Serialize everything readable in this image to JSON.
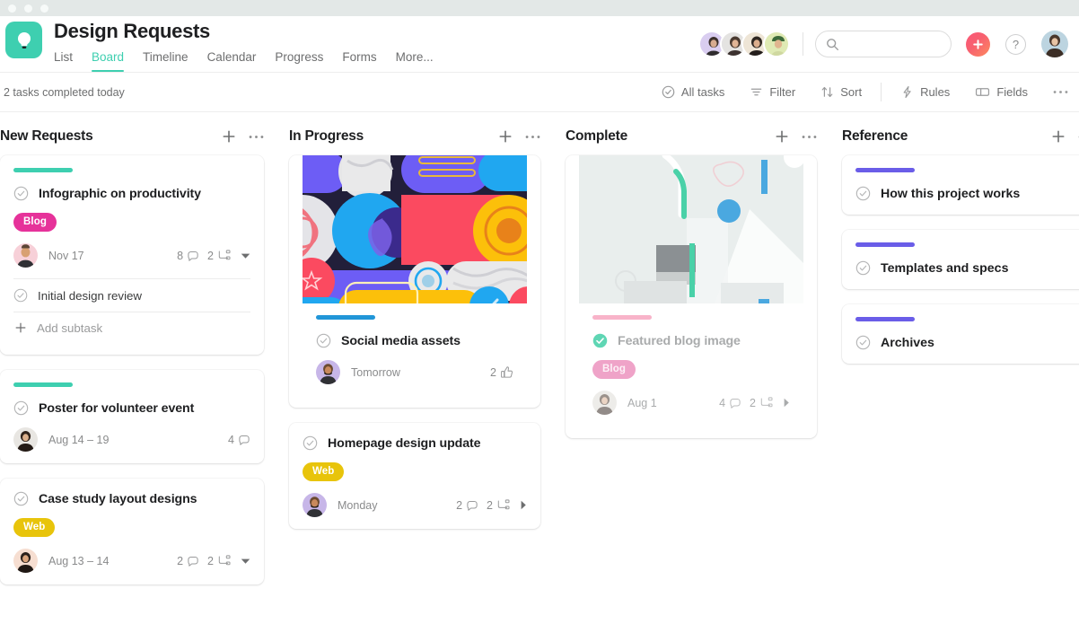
{
  "window": {
    "dots": 3
  },
  "header": {
    "project_title": "Design Requests",
    "logo_icon": "lightbulb-icon",
    "tabs": [
      {
        "label": "List",
        "active": false
      },
      {
        "label": "Board",
        "active": true
      },
      {
        "label": "Timeline",
        "active": false
      },
      {
        "label": "Calendar",
        "active": false
      },
      {
        "label": "Progress",
        "active": false
      },
      {
        "label": "Forms",
        "active": false
      },
      {
        "label": "More...",
        "active": false
      }
    ],
    "accent_color": "#3ecfb0",
    "members": [
      {
        "name": "member-1",
        "bg": "#d9cdf0"
      },
      {
        "name": "member-2",
        "bg": "#e4e3e1"
      },
      {
        "name": "member-3",
        "bg": "#eee5d6"
      },
      {
        "name": "member-4",
        "bg": "#dfeab4"
      }
    ],
    "search": {
      "placeholder": "",
      "value": "",
      "icon": "search-icon"
    },
    "add_button": {
      "icon": "plus-icon",
      "color": "#f7616f"
    },
    "help_button": {
      "label": "?"
    },
    "user_avatar": {
      "name": "current-user",
      "bg": "#bcd4e0"
    }
  },
  "toolbar": {
    "status_text": "2 tasks completed today",
    "items": [
      {
        "label": "All tasks",
        "icon": "check-circle-icon"
      },
      {
        "label": "Filter",
        "icon": "filter-icon"
      },
      {
        "label": "Sort",
        "icon": "sort-icon"
      },
      {
        "label": "Rules",
        "icon": "bolt-icon"
      },
      {
        "label": "Fields",
        "icon": "fields-icon"
      }
    ],
    "overflow_icon": "ellipsis-icon"
  },
  "board": {
    "add_icon": "plus-icon",
    "menu_icon": "ellipsis-icon",
    "columns": [
      {
        "title": "New Requests",
        "cards": [
          {
            "title": "Infographic on productivity",
            "progress_color": "#3ecfb0",
            "tag": {
              "label": "Blog",
              "color": "#e6329a"
            },
            "assignee_bg": "#f7d0d8",
            "date": "Nov 17",
            "stats": [
              {
                "value": "8",
                "icon": "comment-icon"
              },
              {
                "value": "2",
                "icon": "subtask-icon"
              }
            ],
            "expand_icon": "caret-down-icon",
            "subtasks": [
              {
                "label": "Initial design review"
              }
            ],
            "add_subtask_label": "Add subtask"
          },
          {
            "title": "Poster for volunteer event",
            "progress_color": "#3ecfb0",
            "assignee_bg": "#e8e6e2",
            "date": "Aug 14 – 19",
            "stats": [
              {
                "value": "4",
                "icon": "comment-icon"
              }
            ]
          },
          {
            "title": "Case study layout designs",
            "tag": {
              "label": "Web",
              "color": "#e8c40b"
            },
            "assignee_bg": "#f6ded1",
            "date": "Aug 13 – 14",
            "stats": [
              {
                "value": "2",
                "icon": "comment-icon"
              },
              {
                "value": "2",
                "icon": "subtask-icon"
              }
            ],
            "expand_icon": "caret-down-icon"
          }
        ]
      },
      {
        "title": "In Progress",
        "cards": [
          {
            "title": "Social media assets",
            "cover": "abstract-shapes-cover",
            "progress_color": "#2196d8",
            "assignee_bg": "#c7b6e8",
            "date": "Tomorrow",
            "stats": [
              {
                "value": "2",
                "icon": "thumbsup-icon"
              }
            ]
          },
          {
            "title": "Homepage design update",
            "tag": {
              "label": "Web",
              "color": "#e8c40b"
            },
            "assignee_bg": "#c7b6e8",
            "date": "Monday",
            "stats": [
              {
                "value": "2",
                "icon": "comment-icon"
              },
              {
                "value": "2",
                "icon": "subtask-icon"
              }
            ],
            "expand_icon": "caret-right-icon"
          }
        ]
      },
      {
        "title": "Complete",
        "cards": [
          {
            "title": "Featured blog image",
            "cover": "desk-photo-cover",
            "completed": true,
            "progress_color": "#f8b3c9",
            "tag": {
              "label": "Blog",
              "color": "#efa3c8"
            },
            "assignee_bg": "#e0ddd8",
            "date": "Aug 1",
            "stats": [
              {
                "value": "4",
                "icon": "comment-icon"
              },
              {
                "value": "2",
                "icon": "subtask-icon"
              }
            ],
            "expand_icon": "caret-right-icon"
          }
        ]
      },
      {
        "title": "Reference",
        "cards": [
          {
            "title": "How this project works",
            "progress_color": "#6a5de8"
          },
          {
            "title": "Templates and specs",
            "progress_color": "#6a5de8"
          },
          {
            "title": "Archives",
            "progress_color": "#6a5de8"
          }
        ]
      }
    ]
  }
}
